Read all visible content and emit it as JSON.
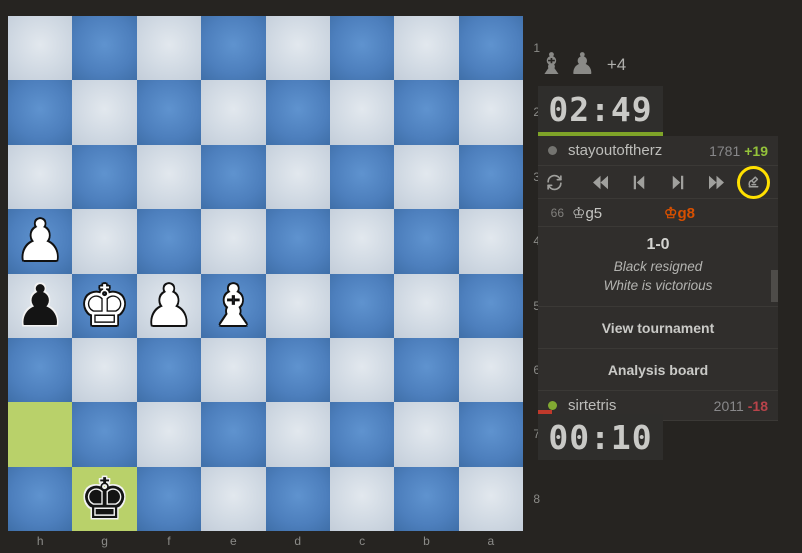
{
  "board": {
    "orientation": "black",
    "files": [
      "h",
      "g",
      "f",
      "e",
      "d",
      "c",
      "b",
      "a"
    ],
    "ranks": [
      "1",
      "2",
      "3",
      "4",
      "5",
      "6",
      "7",
      "8"
    ],
    "light_color": "#cfd8e2",
    "dark_color": "#4d7fbd",
    "highlight_color": "#b9d16a",
    "pieces": [
      {
        "file": "h",
        "rank": "4",
        "glyph": "♟",
        "color": "w",
        "name": "white-pawn"
      },
      {
        "file": "h",
        "rank": "5",
        "glyph": "♟",
        "color": "b",
        "name": "black-pawn"
      },
      {
        "file": "g",
        "rank": "5",
        "glyph": "♚",
        "color": "w",
        "name": "white-king"
      },
      {
        "file": "f",
        "rank": "5",
        "glyph": "♟",
        "color": "w",
        "name": "white-pawn"
      },
      {
        "file": "e",
        "rank": "5",
        "glyph": "♝",
        "color": "w",
        "name": "white-bishop"
      },
      {
        "file": "g",
        "rank": "8",
        "glyph": "♚",
        "color": "b",
        "name": "black-king"
      }
    ],
    "highlighted_squares": [
      {
        "file": "h",
        "rank": "7"
      },
      {
        "file": "g",
        "rank": "8"
      }
    ]
  },
  "panel": {
    "captured": {
      "pieces": [
        "♝",
        "♟"
      ],
      "score": "+4"
    },
    "top": {
      "clock": "02:49",
      "name": "stayoutoftherz",
      "rating": "1781",
      "delta": "+19",
      "status": "offline"
    },
    "bottom": {
      "clock": "00:10",
      "name": "sirtetris",
      "rating": "2011",
      "delta": "-18",
      "status": "online"
    },
    "controls": {
      "flip": "flip-board-icon",
      "first": "first-move-icon",
      "prev": "previous-move-icon",
      "next": "next-move-icon",
      "last": "last-move-icon",
      "analysis": "microscope-icon",
      "highlight_color": "#ffe000"
    },
    "moves": [
      {
        "number": "66",
        "white": "♔g5",
        "black": "♔g8"
      }
    ],
    "result": {
      "score": "1-0",
      "line1": "Black resigned",
      "line2": "White is victorious"
    },
    "buttons": {
      "view_tournament": "View tournament",
      "analysis_board": "Analysis board"
    }
  }
}
